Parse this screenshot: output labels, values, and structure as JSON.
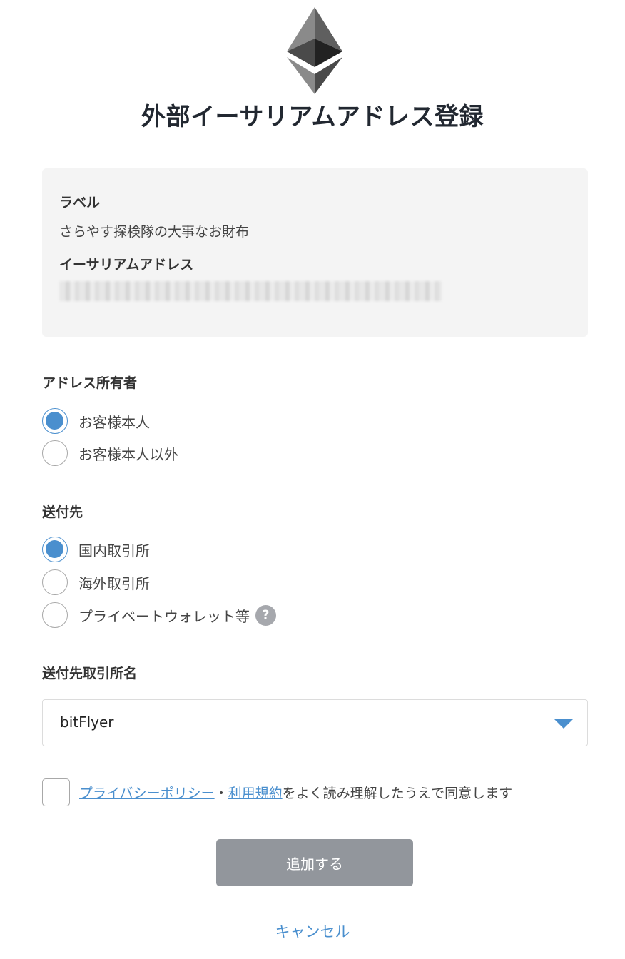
{
  "page": {
    "title": "外部イーサリアムアドレス登録"
  },
  "info": {
    "label_heading": "ラベル",
    "label_value": "さらやす探検隊の大事なお財布",
    "address_heading": "イーサリアムアドレス"
  },
  "owner": {
    "heading": "アドレス所有者",
    "options": [
      {
        "label": "お客様本人",
        "checked": true
      },
      {
        "label": "お客様本人以外",
        "checked": false
      }
    ]
  },
  "destination": {
    "heading": "送付先",
    "options": [
      {
        "label": "国内取引所",
        "checked": true
      },
      {
        "label": "海外取引所",
        "checked": false
      },
      {
        "label": "プライベートウォレット等",
        "checked": false
      }
    ],
    "help_symbol": "?"
  },
  "exchange": {
    "heading": "送付先取引所名",
    "selected": "bitFlyer"
  },
  "agreement": {
    "privacy_link": "プライバシーポリシー",
    "separator": "・",
    "terms_link": "利用規約",
    "text": "をよく読み理解したうえで同意します"
  },
  "actions": {
    "submit_label": "追加する",
    "cancel_label": "キャンセル"
  },
  "colors": {
    "accent": "#4a8fce",
    "button_disabled": "#92969c",
    "info_bg": "#f4f4f4"
  }
}
